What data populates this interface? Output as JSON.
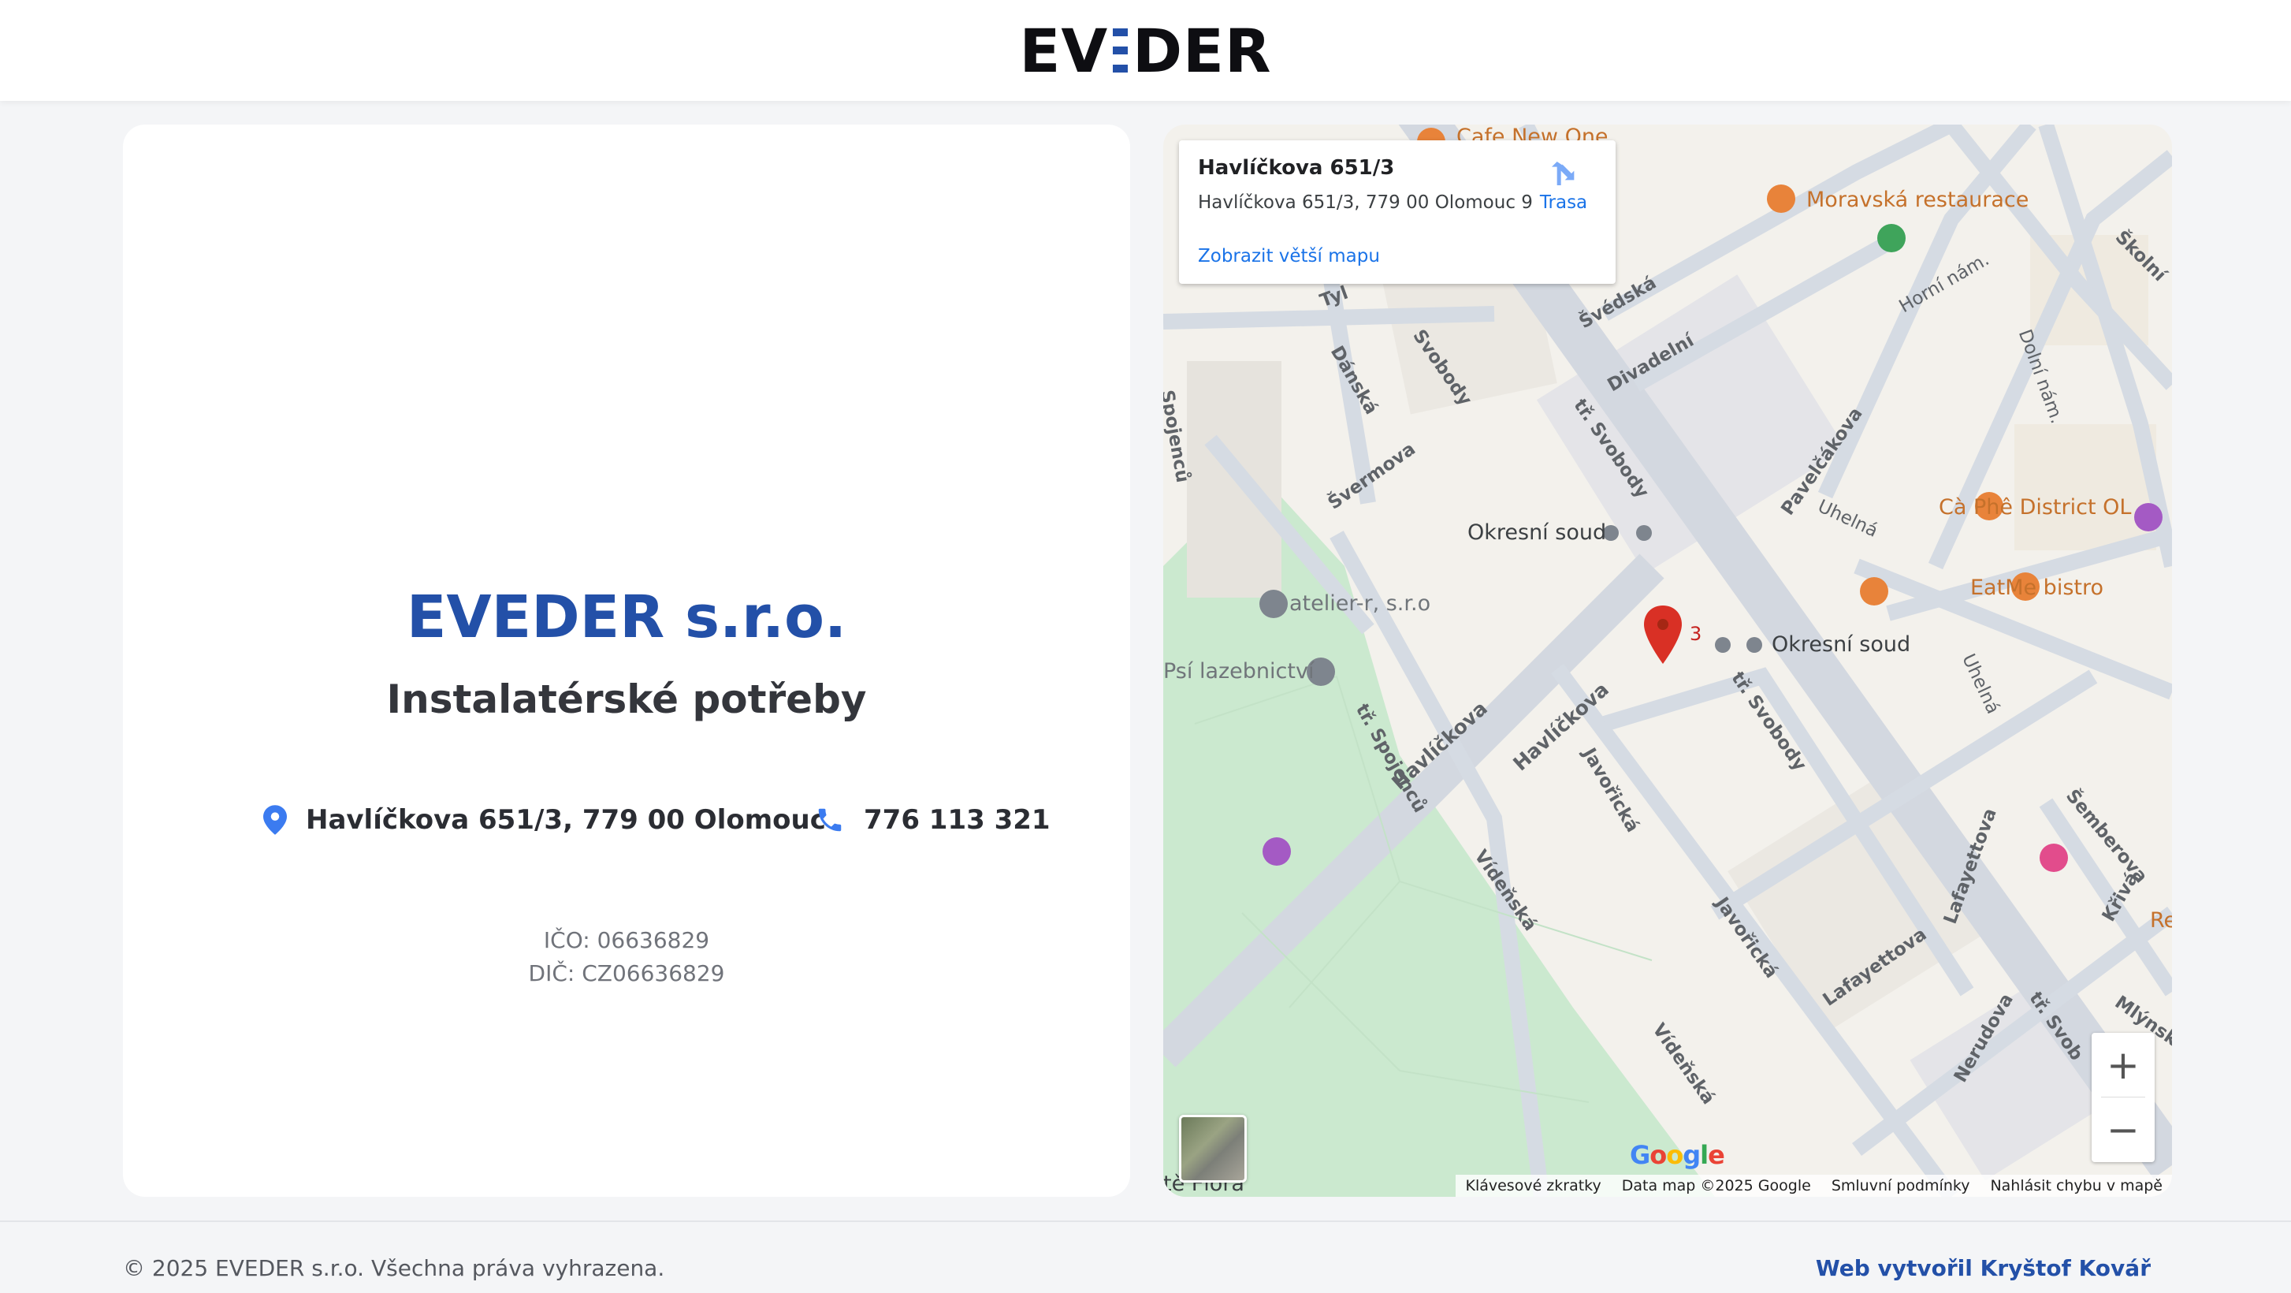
{
  "header": {
    "logo": {
      "part1": "EV",
      "part2": "DER"
    }
  },
  "card": {
    "company": "EVEDER s.r.o.",
    "tagline": "Instalatérské potřeby",
    "address": "Havlíčkova 651/3, 779 00 Olomouc",
    "phone": "776 113 321",
    "ico": "IČO: 06636829",
    "dic": "DIČ: CZ06636829",
    "accent": "#2350a8"
  },
  "map": {
    "infocard": {
      "title": "Havlíčkova 651/3",
      "address": "Havlíčkova 651/3, 779 00 Olomouc 9",
      "route": "Trasa",
      "bigger_map": "Zobrazit větší mapu"
    },
    "pin_label": "3",
    "places": {
      "cafe": "Cafe New One",
      "moravska": "Moravská restaurace",
      "okresni1": "Okresní soud",
      "okresni2": "Okresní soud",
      "atelier": "atelier-r, s.r.o",
      "psi": "Psí lazebnictví",
      "caphe": "Cà Phê District OL",
      "eatme": "EatMe bistro",
      "flora": "tě Flora",
      "re": "Re"
    },
    "streets": {
      "svobody1": "Svobody",
      "svobody2": "tř. Svobody",
      "svobody3": "tř. Svobody",
      "svobody4": "tř. Svob",
      "svedska": "Švédská",
      "divadelni": "Divadelní",
      "danska": "Dánská",
      "svermova": "Švermova",
      "spojencu1": "Spojenců",
      "spojencu2": "tř. Spojenců",
      "havlickova1": "Havlíčkova",
      "havlickova2": "Havlíčkova",
      "javoricska1": "Javořická",
      "javoricska2": "Javořická",
      "videnska1": "Vídeňská",
      "videnska2": "Vídeňská",
      "lafayettova1": "Lafayettova",
      "lafayettova2": "Lafayettova",
      "pavelcakova": "Pavelčákova",
      "uhelna1": "Uhelná",
      "uhelna2": "Uhelná",
      "horni": "Horní nám.",
      "dolni": "Dolní nám.",
      "skolni": "Školní",
      "semberova": "Šemberova",
      "kriva": "Křivá",
      "mlynska": "Mlýnsk",
      "nerudova": "Nerudova",
      "tyl": "Tyl"
    },
    "zoom": {
      "in": "+",
      "out": "−"
    },
    "google": "Google",
    "attribution": {
      "shortcuts": "Klávesové zkratky",
      "data": "Data map ©2025 Google",
      "terms": "Smluvní podmínky",
      "report": "Nahlásit chybu v mapě"
    }
  },
  "footer": {
    "copyright": "© 2025 EVEDER s.r.o. Všechna práva vyhrazena.",
    "credit": "Web vytvořil Kryštof Kovář"
  }
}
